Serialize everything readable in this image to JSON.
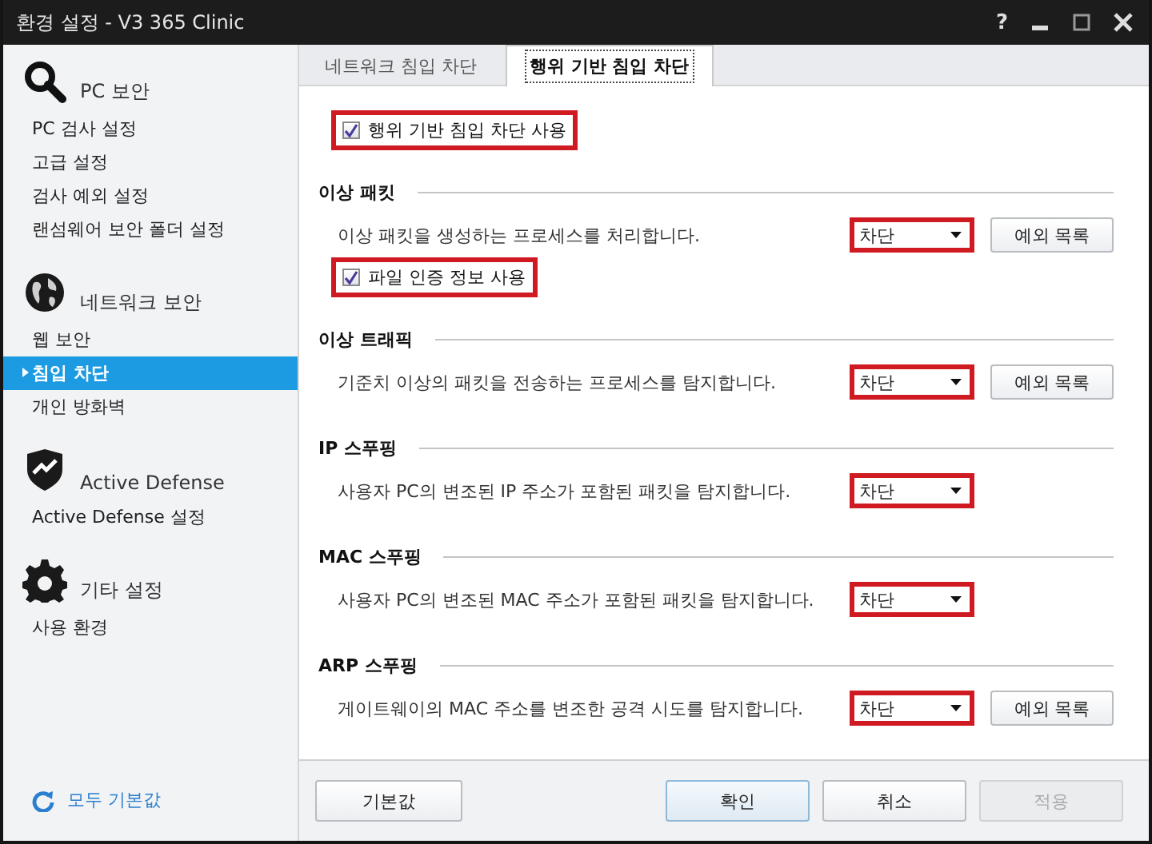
{
  "window": {
    "title": "환경 설정 - V3 365 Clinic",
    "help": "?"
  },
  "sidebar": {
    "groups": [
      {
        "kind": "search",
        "title": "PC 보안",
        "items": [
          {
            "label": "PC 검사 설정",
            "selected": false
          },
          {
            "label": "고급 설정",
            "selected": false
          },
          {
            "label": "검사 예외 설정",
            "selected": false
          },
          {
            "label": "랜섬웨어 보안 폴더 설정",
            "selected": false
          }
        ]
      },
      {
        "kind": "network",
        "title": "네트워크 보안",
        "items": [
          {
            "label": "웹 보안",
            "selected": false
          },
          {
            "label": "침입 차단",
            "selected": true
          },
          {
            "label": "개인 방화벽",
            "selected": false
          }
        ]
      },
      {
        "kind": "defense",
        "title": "Active Defense",
        "items": [
          {
            "label": "Active Defense 설정",
            "selected": false
          }
        ]
      },
      {
        "kind": "other",
        "title": "기타 설정",
        "items": [
          {
            "label": "사용 환경",
            "selected": false
          }
        ]
      }
    ],
    "reset_link": "모두 기본값"
  },
  "tabs": [
    {
      "label": "네트워크 침입 차단",
      "selected": false
    },
    {
      "label": "행위 기반 침입 차단",
      "selected": true
    }
  ],
  "content": [
    {
      "kind": "checkbox",
      "label": "행위 기반 침입 차단 사용",
      "checked": true,
      "highlighted": true
    },
    {
      "kind": "section",
      "title": "이상 패킷"
    },
    {
      "kind": "setting",
      "description": "이상 패킷을 생성하는 프로세스를 처리합니다.",
      "dropdown": {
        "value": "차단",
        "highlighted": true
      },
      "button": "예외 목록"
    },
    {
      "kind": "checkbox",
      "label": "파일 인증 정보 사용",
      "checked": true,
      "highlighted": true
    },
    {
      "kind": "section",
      "title": "이상 트래픽"
    },
    {
      "kind": "setting",
      "description": "기준치 이상의 패킷을 전송하는 프로세스를 탐지합니다.",
      "dropdown": {
        "value": "차단",
        "highlighted": true
      },
      "button": "예외 목록"
    },
    {
      "kind": "section",
      "title": "IP 스푸핑"
    },
    {
      "kind": "setting",
      "description": "사용자 PC의 변조된 IP 주소가 포함된 패킷을 탐지합니다.",
      "dropdown": {
        "value": "차단",
        "highlighted": true
      }
    },
    {
      "kind": "section",
      "title": "MAC 스푸핑"
    },
    {
      "kind": "setting",
      "description": "사용자 PC의 변조된 MAC 주소가 포함된 패킷을 탐지합니다.",
      "dropdown": {
        "value": "차단",
        "highlighted": true
      }
    },
    {
      "kind": "section",
      "title": "ARP 스푸핑"
    },
    {
      "kind": "setting",
      "description": "게이트웨이의 MAC 주소를 변조한 공격 시도를 탐지합니다.",
      "dropdown": {
        "value": "차단",
        "highlighted": true
      },
      "button": "예외 목록"
    }
  ],
  "footer": [
    {
      "label": "기본값",
      "kind": "left",
      "disabled": false
    },
    {
      "label": "확인",
      "kind": "default",
      "disabled": false
    },
    {
      "label": "취소",
      "kind": "normal",
      "disabled": false
    },
    {
      "label": "적용",
      "kind": "normal",
      "disabled": true
    }
  ]
}
